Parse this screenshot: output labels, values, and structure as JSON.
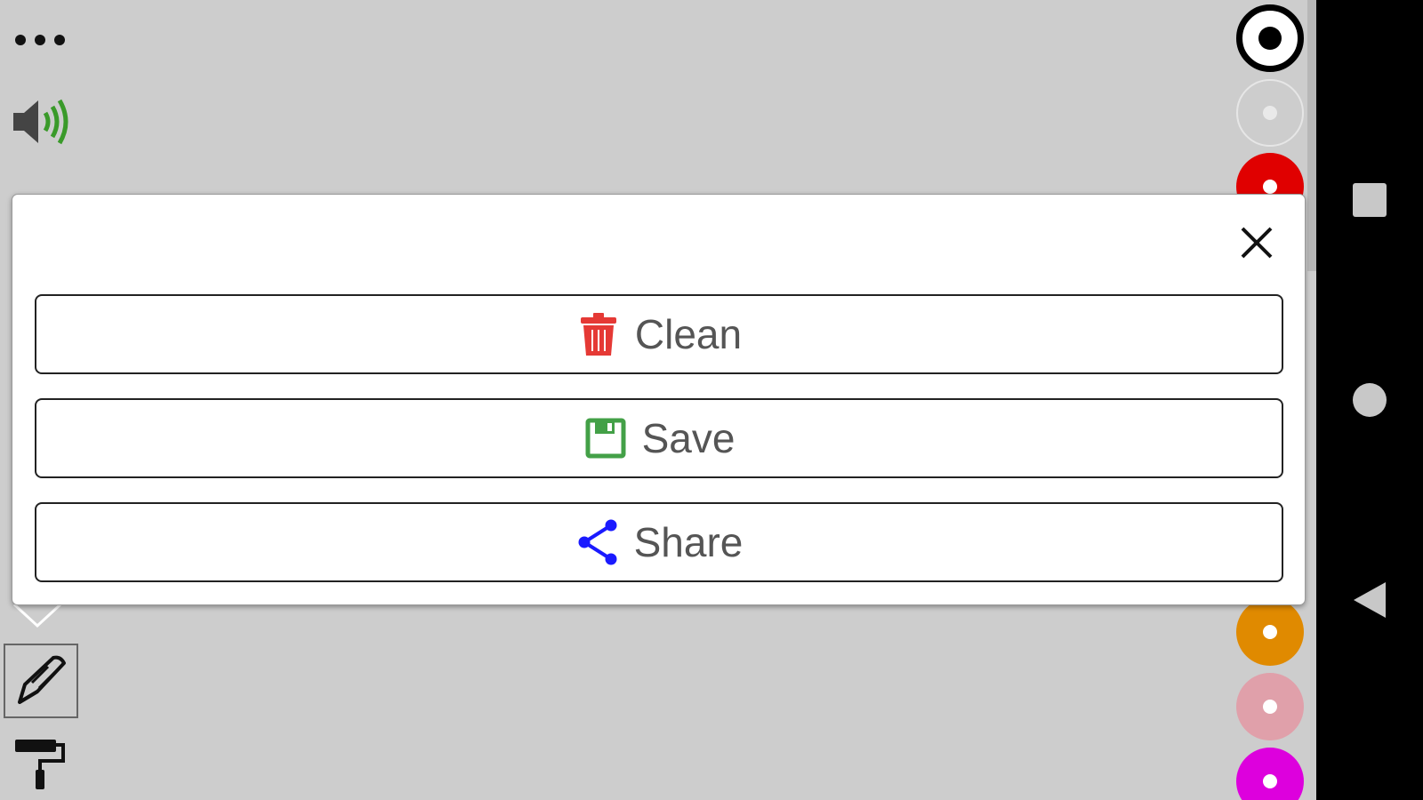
{
  "dialog": {
    "close_icon": "close-icon",
    "actions": [
      {
        "label": "Clean",
        "icon": "trash-icon",
        "color": "#e53935"
      },
      {
        "label": "Save",
        "icon": "floppy-disk-icon",
        "color": "#43a047"
      },
      {
        "label": "Share",
        "icon": "share-icon",
        "color": "#1a1aff"
      }
    ]
  },
  "toolbar_left": {
    "items": [
      "more-icon",
      "sound-icon",
      "pen-icon",
      "paint-roller-icon"
    ]
  },
  "palette": {
    "selected": "#000000",
    "colors": [
      "#000000",
      "#ffffff",
      "#e00000",
      "#e08a00",
      "#e0a0aa",
      "#dd00dd"
    ]
  },
  "system_nav": [
    "recents-icon",
    "home-icon",
    "back-icon"
  ]
}
